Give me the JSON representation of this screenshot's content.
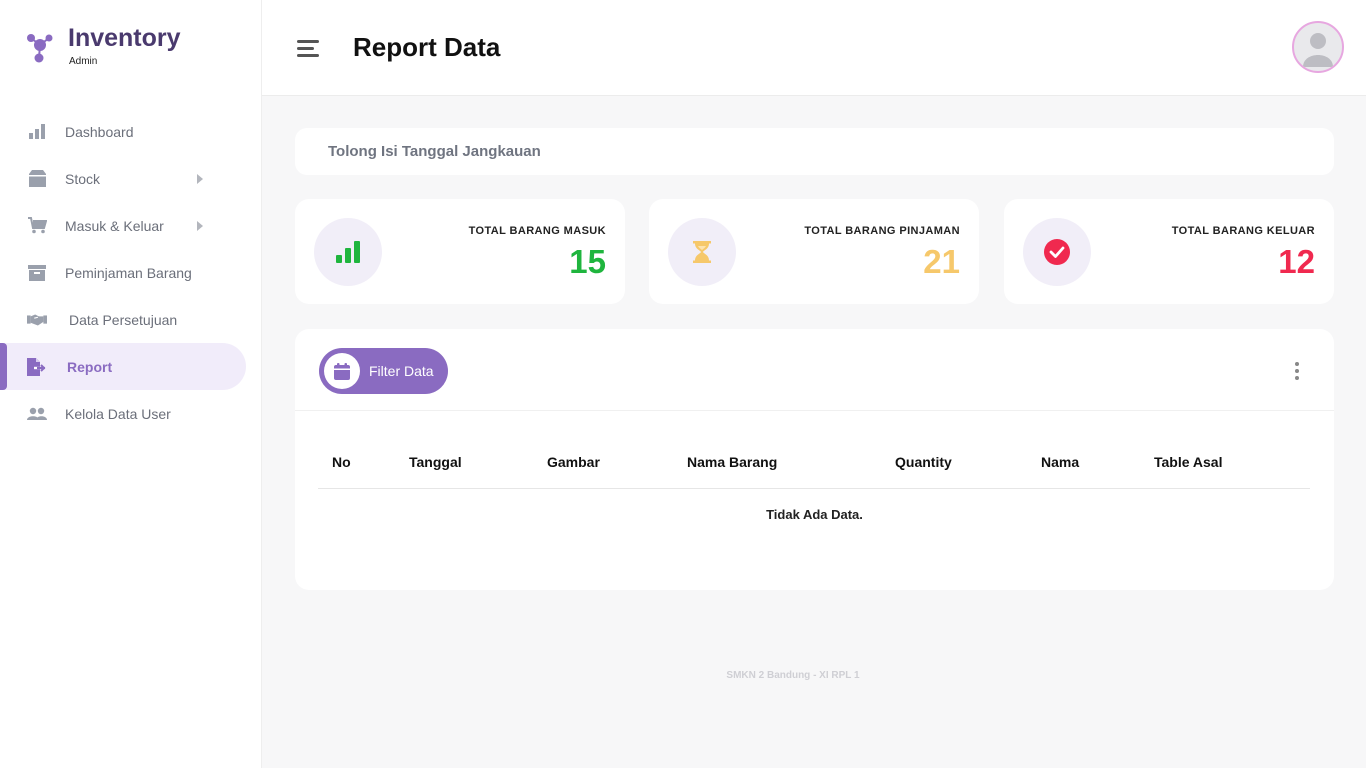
{
  "brand": {
    "title": "Inventory",
    "subtitle": "Admin"
  },
  "sidebar": {
    "items": [
      {
        "label": "Dashboard",
        "icon": "bar-chart-icon"
      },
      {
        "label": "Stock",
        "icon": "box-icon"
      },
      {
        "label": "Masuk & Keluar",
        "icon": "cart-icon"
      },
      {
        "label": "Peminjaman Barang",
        "icon": "archive-icon"
      },
      {
        "label": "Data Persetujuan",
        "icon": "handshake-icon"
      },
      {
        "label": "Report",
        "icon": "file-export-icon"
      },
      {
        "label": "Kelola Data User",
        "icon": "users-icon"
      }
    ],
    "active": "Report"
  },
  "header": {
    "title": "Report Data"
  },
  "range": {
    "text": "Tolong Isi Tanggal Jangkauan"
  },
  "cards": [
    {
      "label": "TOTAL BARANG MASUK",
      "value": "15",
      "color": "#1fb53e",
      "icon": "signal-bars-icon"
    },
    {
      "label": "TOTAL BARANG PINJAMAN",
      "value": "21",
      "color": "#f6c86b",
      "icon": "hourglass-icon"
    },
    {
      "label": "TOTAL BARANG KELUAR",
      "value": "12",
      "color": "#f0294f",
      "icon": "check-circle-icon"
    }
  ],
  "table": {
    "filter_label": "Filter Data",
    "columns": [
      "No",
      "Tanggal",
      "Gambar",
      "Nama Barang",
      "Quantity",
      "Nama",
      "Table Asal"
    ],
    "empty_text": "Tidak Ada Data."
  },
  "footer": {
    "text": "SMKN 2 Bandung - XI RPL 1"
  },
  "colors": {
    "accent": "#8a6bc1",
    "brand_text": "#4a3a6e"
  }
}
